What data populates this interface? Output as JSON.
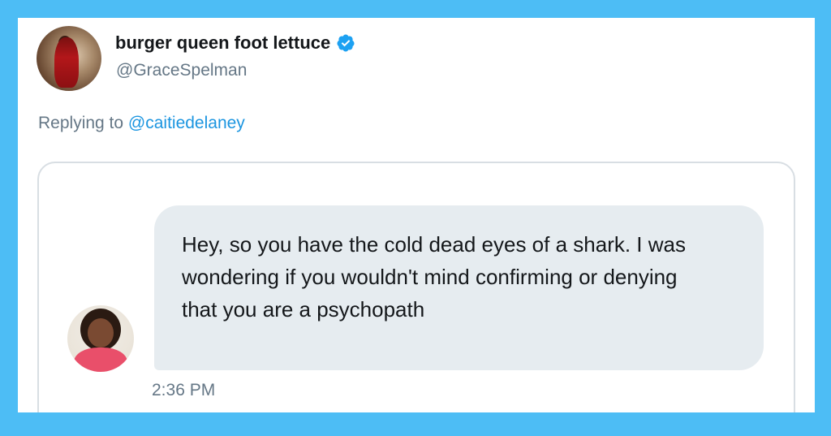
{
  "tweet": {
    "display_name": "burger queen foot lettuce",
    "handle": "@GraceSpelman",
    "replying_prefix": "Replying to",
    "replying_to": "@caitiedelaney",
    "verified_icon": "verified-badge-icon"
  },
  "dm": {
    "message": "Hey, so you have the cold dead eyes of a shark. I was wondering if you wouldn't mind confirming or denying that you are a psychopath",
    "timestamp": "2:36 PM"
  },
  "colors": {
    "frame": "#4dbdf5",
    "card": "#ffffff",
    "name": "#14171a",
    "secondary": "#657786",
    "link": "#1b95e0",
    "bubble": "#e6ecf0",
    "verified": "#1da1f2"
  }
}
